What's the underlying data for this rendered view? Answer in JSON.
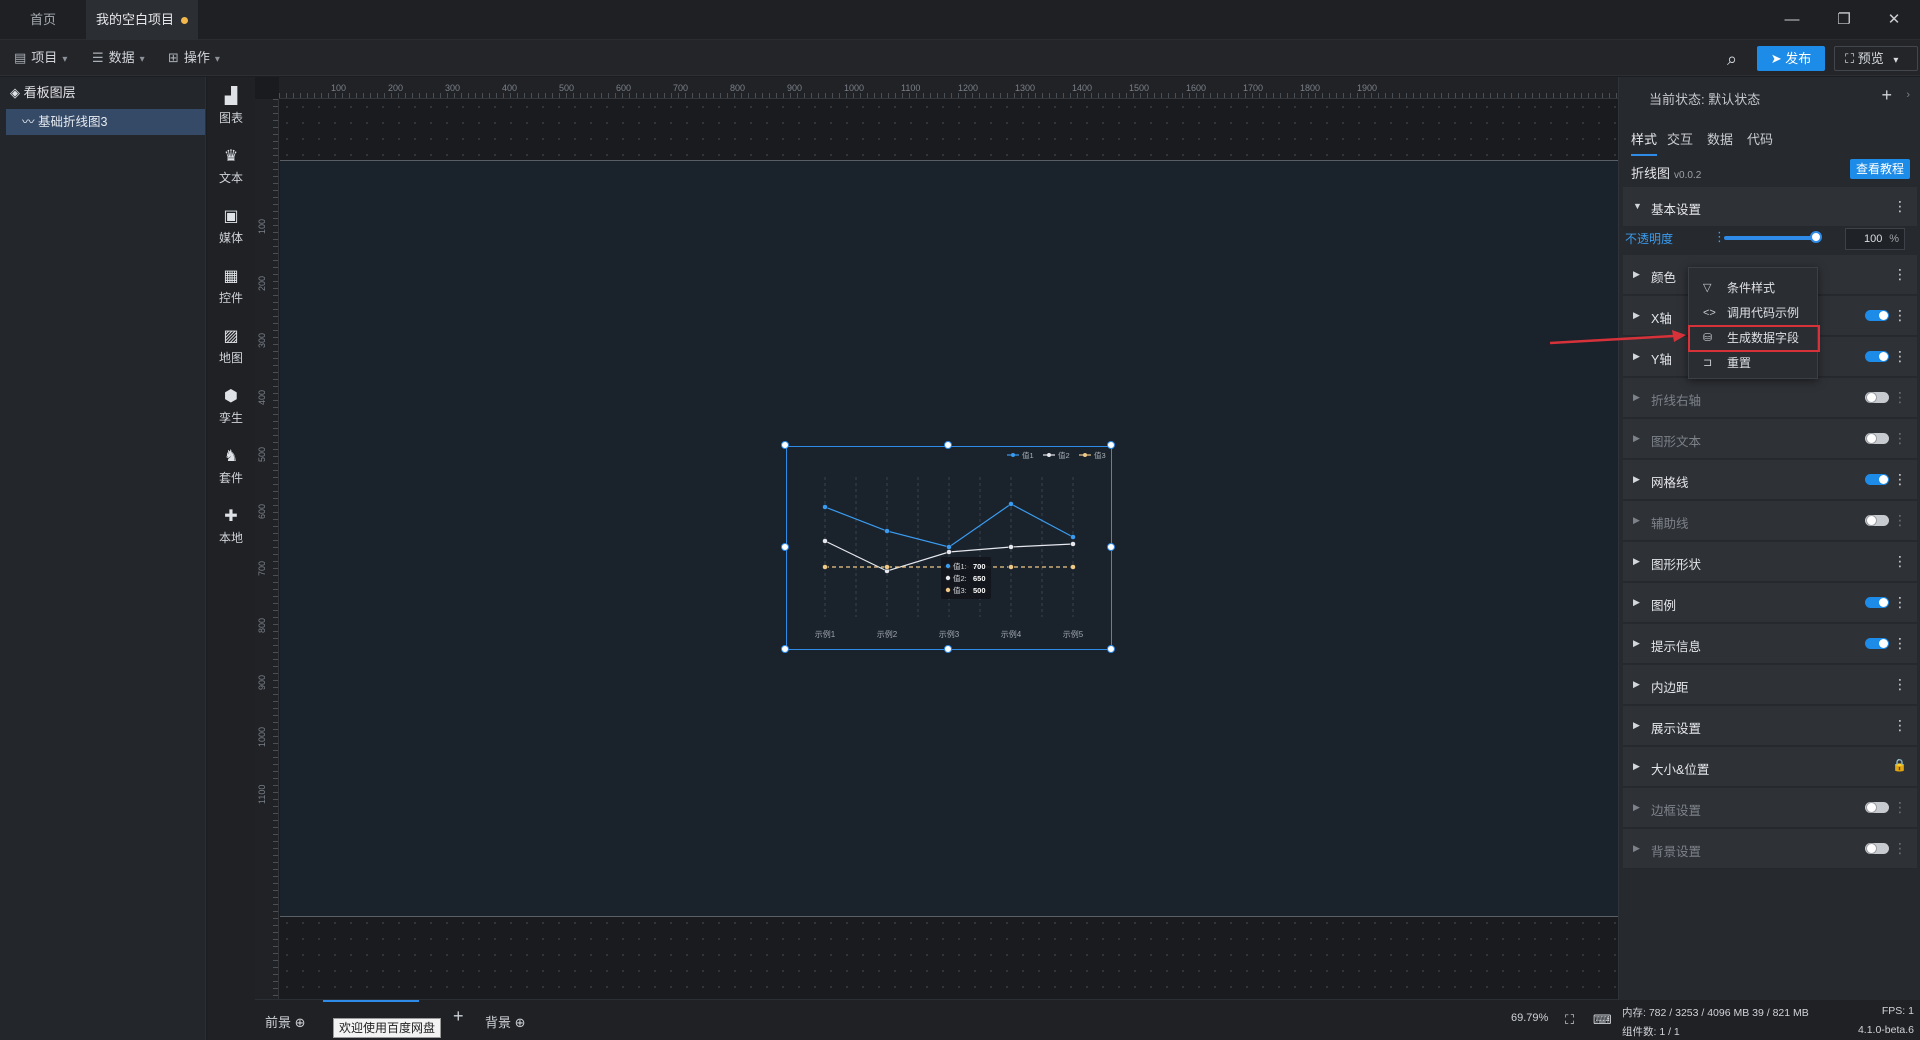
{
  "tabs": [
    {
      "label": "首页"
    },
    {
      "label": "我的空白项目"
    }
  ],
  "window": {
    "minimize": "—",
    "restore": "❐",
    "close": "✕"
  },
  "menubar": {
    "items": [
      {
        "label": "项目"
      },
      {
        "label": "数据"
      },
      {
        "label": "操作"
      }
    ],
    "publish": "发布",
    "preview": "预览"
  },
  "layers": {
    "title": "看板图层",
    "items": [
      {
        "label": "基础折线图3"
      }
    ]
  },
  "components": [
    {
      "label": "图表",
      "icon": "bar-chart-icon"
    },
    {
      "label": "文本",
      "icon": "text-icon"
    },
    {
      "label": "媒体",
      "icon": "media-icon"
    },
    {
      "label": "控件",
      "icon": "control-icon"
    },
    {
      "label": "地图",
      "icon": "map-icon"
    },
    {
      "label": "孪生",
      "icon": "twin-icon"
    },
    {
      "label": "套件",
      "icon": "kit-icon"
    },
    {
      "label": "本地",
      "icon": "local-icon"
    }
  ],
  "ruler": {
    "h": [
      "100",
      "200",
      "300",
      "400",
      "500",
      "600",
      "700",
      "800",
      "900",
      "1000",
      "1100",
      "1200",
      "1300",
      "1400",
      "1500",
      "1600",
      "1700",
      "1800",
      "1900"
    ],
    "v": [
      "100",
      "200",
      "300",
      "400",
      "500",
      "600",
      "700",
      "800",
      "900",
      "1000",
      "1100"
    ]
  },
  "chart_data": {
    "type": "line",
    "categories": [
      "示例1",
      "示例2",
      "示例3",
      "示例4",
      "示例5"
    ],
    "series": [
      {
        "name": "值1",
        "values": [
          1100,
          860,
          700,
          1130,
          800
        ],
        "color": "#3a9cf0"
      },
      {
        "name": "值2",
        "values": [
          760,
          460,
          650,
          700,
          730
        ],
        "color": "#e6e8ee"
      },
      {
        "name": "值3",
        "values": [
          500,
          500,
          500,
          500,
          500
        ],
        "color": "#f0c987"
      }
    ],
    "tooltip": [
      {
        "name": "值1",
        "value": "700"
      },
      {
        "name": "值2",
        "value": "650"
      },
      {
        "name": "值3",
        "value": "500"
      }
    ],
    "ylim": [
      0,
      1500
    ],
    "legend": "top-right"
  },
  "bottom": {
    "front": "前景",
    "back": "背景",
    "zoom": "69.79%",
    "tooltip": "欢迎使用百度网盘"
  },
  "rpanel": {
    "status_label": "当前状态:",
    "status_value": "默认状态",
    "tabs": [
      {
        "label": "样式"
      },
      {
        "label": "交互"
      },
      {
        "label": "数据"
      },
      {
        "label": "代码"
      }
    ],
    "widget": "折线图",
    "version": "v0.0.2",
    "tutorial": "查看教程",
    "basic": "基本设置",
    "opacity_label": "不透明度",
    "opacity_value": "100",
    "opacity_unit": "%",
    "sections": [
      {
        "label": "颜色",
        "toggle": null
      },
      {
        "label": "X轴",
        "toggle": "on"
      },
      {
        "label": "Y轴",
        "toggle": "on"
      },
      {
        "label": "折线右轴",
        "toggle": "off"
      },
      {
        "label": "图形文本",
        "toggle": "off"
      },
      {
        "label": "网格线",
        "toggle": "on"
      },
      {
        "label": "辅助线",
        "toggle": "off"
      },
      {
        "label": "图形形状",
        "toggle": null
      },
      {
        "label": "图例",
        "toggle": "on"
      },
      {
        "label": "提示信息",
        "toggle": "on"
      },
      {
        "label": "内边距",
        "toggle": null
      },
      {
        "label": "展示设置",
        "toggle": null
      },
      {
        "label": "大小&位置",
        "toggle": "lock"
      },
      {
        "label": "边框设置",
        "toggle": "off"
      },
      {
        "label": "背景设置",
        "toggle": "off"
      }
    ],
    "context_menu": [
      {
        "label": "条件样式",
        "icon": "filter-icon"
      },
      {
        "label": "调用代码示例",
        "icon": "code-icon"
      },
      {
        "label": "生成数据字段",
        "icon": "database-icon"
      },
      {
        "label": "重置",
        "icon": "reset-icon"
      }
    ]
  },
  "statusbar": {
    "memory": "内存: 782 / 3253 / 4096 MB  39 / 821 MB",
    "fps": "FPS: 1",
    "count": "组件数: 1 / 1",
    "version": "4.1.0-beta.6"
  }
}
